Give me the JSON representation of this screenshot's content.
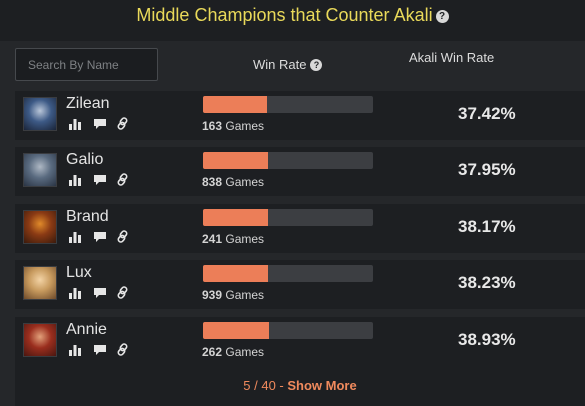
{
  "title": "Middle Champions that Counter Akali",
  "search": {
    "placeholder": "Search By Name"
  },
  "columns": {
    "win_rate": "Win Rate",
    "akali_win_rate": "Akali Win Rate"
  },
  "games_suffix": "Games",
  "champions": [
    {
      "name": "Zilean",
      "games": "163",
      "win_rate_fraction": 0.375,
      "akali_win_rate": "37.42%",
      "portrait": [
        "#3d5a86",
        "#b9c6d9",
        "#1a2438"
      ]
    },
    {
      "name": "Galio",
      "games": "838",
      "win_rate_fraction": 0.38,
      "akali_win_rate": "37.95%",
      "portrait": [
        "#5a6b80",
        "#aeb8c4",
        "#2a3444"
      ]
    },
    {
      "name": "Brand",
      "games": "241",
      "win_rate_fraction": 0.383,
      "akali_win_rate": "38.17%",
      "portrait": [
        "#8a3a14",
        "#e08a2a",
        "#3a1a0c"
      ]
    },
    {
      "name": "Lux",
      "games": "939",
      "win_rate_fraction": 0.385,
      "akali_win_rate": "38.23%",
      "portrait": [
        "#c79a5e",
        "#f3d3a5",
        "#6e4a2a"
      ]
    },
    {
      "name": "Annie",
      "games": "262",
      "win_rate_fraction": 0.39,
      "akali_win_rate": "38.93%",
      "portrait": [
        "#9a2e1e",
        "#e2a07a",
        "#4a1610"
      ]
    }
  ],
  "footer": {
    "page": "5 / 40 - ",
    "show_more": "Show More"
  },
  "colors": {
    "title": "#e9d95a",
    "bar_fill": "#ec7e58",
    "bar_track": "#3c3e42",
    "accent": "#f08a5d"
  }
}
